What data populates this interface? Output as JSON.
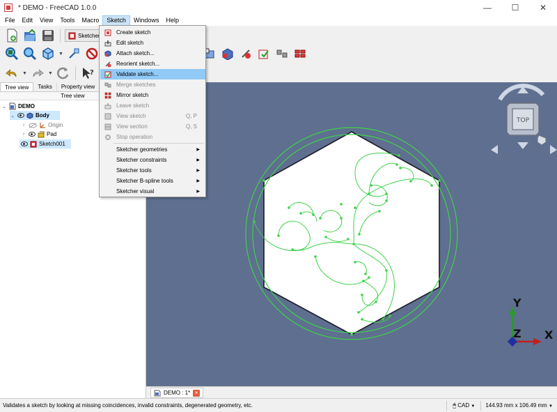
{
  "window": {
    "title": "* DEMO - FreeCAD 1.0.0",
    "minimize": "—",
    "maximize": "☐",
    "close": "✕"
  },
  "menubar": {
    "items": [
      "File",
      "Edit",
      "View",
      "Tools",
      "Macro",
      "Sketch",
      "Windows",
      "Help"
    ],
    "active": "Sketch"
  },
  "toolbar": {
    "workbench_label": "Sketcher"
  },
  "left_panel": {
    "tabs": [
      "Tree view",
      "Tasks",
      "Property view"
    ],
    "active_tab": "Tree view",
    "header": "Tree view",
    "tree": {
      "root": "DEMO",
      "body": "Body",
      "origin": "Origin",
      "pad": "Pad",
      "sketch": "Sketch001"
    }
  },
  "sketch_menu": {
    "items": [
      {
        "label": "Create sketch",
        "enabled": true
      },
      {
        "label": "Edit sketch",
        "enabled": true
      },
      {
        "label": "Attach sketch...",
        "enabled": true
      },
      {
        "label": "Reorient sketch...",
        "enabled": true
      },
      {
        "label": "Validate sketch...",
        "enabled": true,
        "highlighted": true
      },
      {
        "label": "Merge sketches",
        "enabled": false
      },
      {
        "label": "Mirror sketch",
        "enabled": true
      },
      {
        "label": "Leave sketch",
        "enabled": false
      },
      {
        "label": "View sketch",
        "enabled": false,
        "shortcut": "Q, P"
      },
      {
        "label": "View section",
        "enabled": false,
        "shortcut": "Q, S"
      },
      {
        "label": "Stop operation",
        "enabled": false
      },
      {
        "label": "Sketcher geometries",
        "enabled": true,
        "submenu": true
      },
      {
        "label": "Sketcher constraints",
        "enabled": true,
        "submenu": true
      },
      {
        "label": "Sketcher tools",
        "enabled": true,
        "submenu": true
      },
      {
        "label": "Sketcher B-spline tools",
        "enabled": true,
        "submenu": true
      },
      {
        "label": "Sketcher visual",
        "enabled": true,
        "submenu": true
      }
    ]
  },
  "view3d": {
    "navcube_face": "TOP",
    "axis_x": "X",
    "axis_y": "Y",
    "axis_z": "Z"
  },
  "doc_tab": {
    "label": "DEMO : 1*"
  },
  "statusbar": {
    "message": "Validates a sketch by looking at missing coincidences, invalid constraints, degenerated geometry, etc.",
    "nav_style": "CAD",
    "dimensions": "144.93 mm x 106.49 mm"
  },
  "colors": {
    "view_background": "#5e6f8f",
    "sketch_green": "#3fd24a",
    "menu_highlight": "#91c9f7"
  }
}
